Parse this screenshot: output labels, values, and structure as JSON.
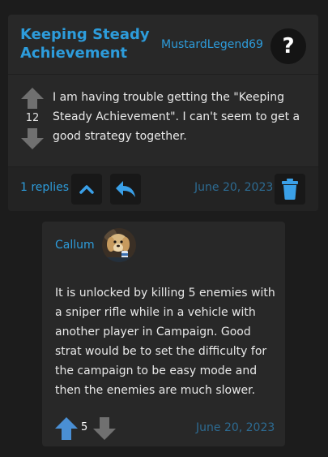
{
  "post": {
    "title": "Keeping Steady Achievement",
    "author": "MustardLegend69",
    "avatar_icon": "question-mark-icon",
    "avatar_glyph": "?",
    "votes": "12",
    "body": "I am having trouble getting the \"Keeping Steady Achievement\". I can't seem to get a good strategy together.",
    "replies_label": "1 replies",
    "date": "June 20, 2023"
  },
  "reply": {
    "author": "Callum",
    "avatar_icon": "dog-photo-avatar",
    "body": "It is unlocked by killing 5 enemies with a sniper rifle while in a vehicle with another player in Campaign. Good strat would be to set the difficulty for the campaign to be easy mode and then the enemies are much slower.",
    "votes": "5",
    "date": "June 20, 2023",
    "upvoted": true
  },
  "colors": {
    "accent": "#2d9cdb",
    "date": "#2d6b92",
    "vote_inactive": "#707070",
    "vote_active": "#4a8fd4",
    "icon_button": "#3aa0e8"
  }
}
